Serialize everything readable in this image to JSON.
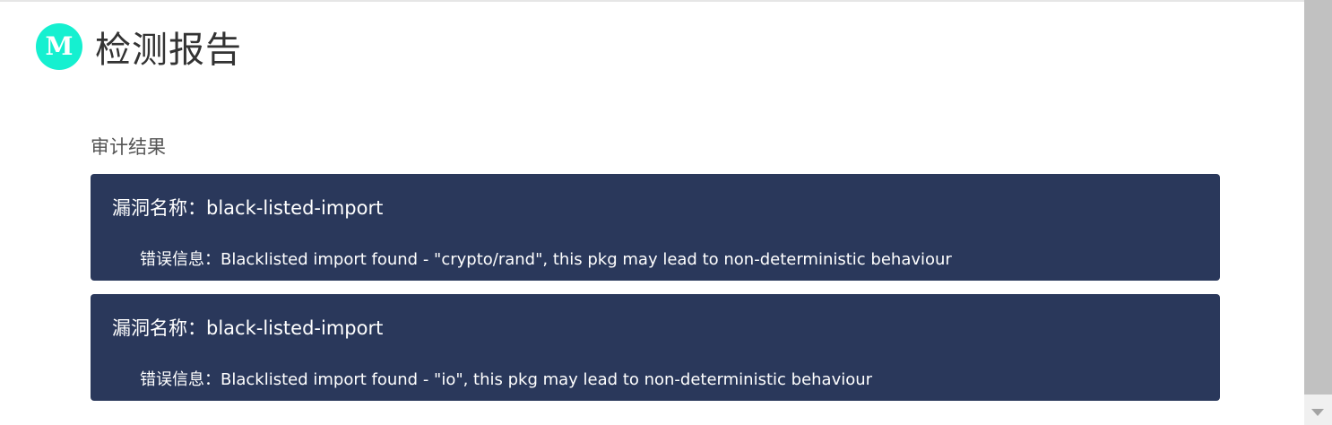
{
  "header": {
    "logo_letter": "M",
    "title": "检测报告"
  },
  "section": {
    "title": "审计结果"
  },
  "results": [
    {
      "name": "漏洞名称：black-listed-import",
      "message": "错误信息：Blacklisted import found - \"crypto/rand\", this pkg may lead to non-deterministic behaviour"
    },
    {
      "name": "漏洞名称：black-listed-import",
      "message": "错误信息：Blacklisted import found - \"io\", this pkg may lead to non-deterministic behaviour"
    }
  ],
  "colors": {
    "card_bg": "#2a385b",
    "logo_bg": "#15f0d0",
    "text_on_card": "#ffffff"
  }
}
